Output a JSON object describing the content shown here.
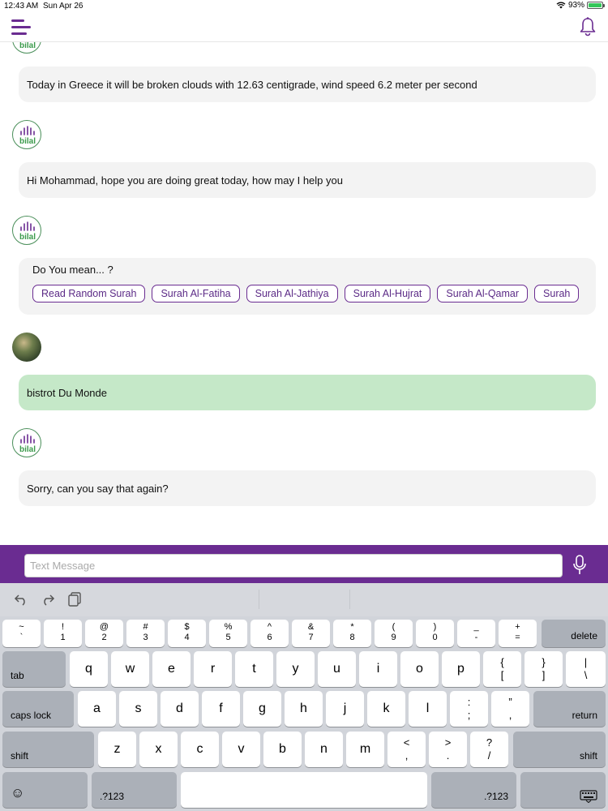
{
  "status_bar": {
    "time": "12:43 AM",
    "date": "Sun Apr 26",
    "battery": "93%"
  },
  "colors": {
    "brand": "#6a2c91",
    "user_bubble": "#c5e8c8",
    "bot_bubble": "#f3f3f3"
  },
  "messages": {
    "m1": {
      "text": "Today in Greece it will be broken clouds with 12.63 centigrade, wind speed 6.2 meter per second"
    },
    "m2": {
      "text": "Hi Mohammad, hope you are doing great today, how may I help you"
    },
    "suggestions": {
      "title": "Do You mean... ?",
      "chips": [
        "Read Random Surah",
        "Surah Al-Fatiha",
        "Surah Al-Jathiya",
        "Surah Al-Hujrat",
        "Surah Al-Qamar",
        "Surah"
      ]
    },
    "user": {
      "text": "bistrot Du Monde"
    },
    "m3": {
      "text": "Sorry, can you say that again?"
    }
  },
  "bot_avatar_logo": "bilal",
  "composer": {
    "placeholder": "Text Message",
    "value": ""
  },
  "keyboard": {
    "row1": [
      {
        "top": "~",
        "bot": "`"
      },
      {
        "top": "!",
        "bot": "1"
      },
      {
        "top": "@",
        "bot": "2"
      },
      {
        "top": "#",
        "bot": "3"
      },
      {
        "top": "$",
        "bot": "4"
      },
      {
        "top": "%",
        "bot": "5"
      },
      {
        "top": "^",
        "bot": "6"
      },
      {
        "top": "&",
        "bot": "7"
      },
      {
        "top": "*",
        "bot": "8"
      },
      {
        "top": "(",
        "bot": "9"
      },
      {
        "top": ")",
        "bot": "0"
      },
      {
        "top": "_",
        "bot": "-"
      },
      {
        "top": "+",
        "bot": "="
      }
    ],
    "delete": "delete",
    "tab": "tab",
    "row2": [
      "q",
      "w",
      "e",
      "r",
      "t",
      "y",
      "u",
      "i",
      "o",
      "p"
    ],
    "row2_symbols": [
      {
        "top": "{",
        "bot": "["
      },
      {
        "top": "}",
        "bot": "]"
      },
      {
        "top": "|",
        "bot": "\\"
      }
    ],
    "caps_lock": "caps lock",
    "row3": [
      "a",
      "s",
      "d",
      "f",
      "g",
      "h",
      "j",
      "k",
      "l"
    ],
    "row3_symbols": [
      {
        "top": ":",
        "bot": ";"
      },
      {
        "top": "”",
        "bot": ","
      }
    ],
    "return": "return",
    "shift": "shift",
    "row4": [
      "z",
      "x",
      "c",
      "v",
      "b",
      "n",
      "m"
    ],
    "row4_symbols": [
      {
        "top": "<",
        "bot": ","
      },
      {
        "top": ">",
        "bot": "."
      },
      {
        "top": "?",
        "bot": "/"
      }
    ],
    "numbers_key": ".?123",
    "emoji": "☺"
  },
  "icons": [
    "menu-icon",
    "bell-icon",
    "mic-icon",
    "undo-icon",
    "redo-icon",
    "paste-icon",
    "keyboard-dismiss-icon",
    "emoji-icon"
  ]
}
